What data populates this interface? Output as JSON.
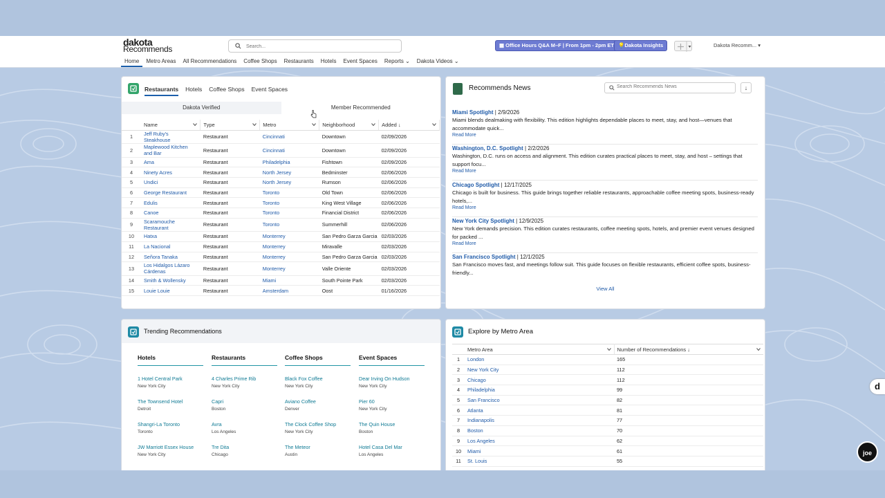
{
  "logo": {
    "line1": "dakota",
    "line2": "Recommends"
  },
  "search": {
    "placeholder": "Search..."
  },
  "header": {
    "office_hours": "Office Hours Q&A M–F  |  From 1pm - 2pm ET",
    "insights": "Dakota Insights",
    "user": "Dakota Recomm..."
  },
  "nav": [
    "Home",
    "Metro Areas",
    "All Recommendations",
    "Coffee Shops",
    "Restaurants",
    "Hotels",
    "Event Spaces",
    "Reports",
    "Dakota Videos"
  ],
  "recs": {
    "tabs": [
      "Restaurants",
      "Hotels",
      "Coffee Shops",
      "Event Spaces"
    ],
    "subtabs": [
      "Dakota Verified",
      "Member Recommended"
    ],
    "columns": [
      "Name",
      "Type",
      "Metro",
      "Neighborhood",
      "Added ↓"
    ],
    "rows": [
      {
        "n": "1",
        "name": "Jeff Ruby's Steakhouse",
        "type": "Restaurant",
        "metro": "Cincinnati",
        "hood": "Downtown",
        "added": "02/09/2026"
      },
      {
        "n": "2",
        "name": "Maplewood Kitchen and Bar",
        "type": "Restaurant",
        "metro": "Cincinnati",
        "hood": "Downtown",
        "added": "02/09/2026"
      },
      {
        "n": "3",
        "name": "Ama",
        "type": "Restaurant",
        "metro": "Philadelphia",
        "hood": "Fishtown",
        "added": "02/09/2026"
      },
      {
        "n": "4",
        "name": "Ninety Acres",
        "type": "Restaurant",
        "metro": "North Jersey",
        "hood": "Bedminster",
        "added": "02/06/2026"
      },
      {
        "n": "5",
        "name": "Undici",
        "type": "Restaurant",
        "metro": "North Jersey",
        "hood": "Rumson",
        "added": "02/06/2026"
      },
      {
        "n": "6",
        "name": "George Restaurant",
        "type": "Restaurant",
        "metro": "Toronto",
        "hood": "Old Town",
        "added": "02/06/2026"
      },
      {
        "n": "7",
        "name": "Edulis",
        "type": "Restaurant",
        "metro": "Toronto",
        "hood": "King West Village",
        "added": "02/06/2026"
      },
      {
        "n": "8",
        "name": "Canoe",
        "type": "Restaurant",
        "metro": "Toronto",
        "hood": "Financial District",
        "added": "02/06/2026"
      },
      {
        "n": "9",
        "name": "Scaramouche Restaurant",
        "type": "Restaurant",
        "metro": "Toronto",
        "hood": "Summerhill",
        "added": "02/06/2026"
      },
      {
        "n": "10",
        "name": "Hatxa",
        "type": "Restaurant",
        "metro": "Monterrey",
        "hood": "San Pedro Garza Garcia",
        "added": "02/03/2026"
      },
      {
        "n": "11",
        "name": "La Nacional",
        "type": "Restaurant",
        "metro": "Monterrey",
        "hood": "Miravalle",
        "added": "02/03/2026"
      },
      {
        "n": "12",
        "name": "Señora Tanaka",
        "type": "Restaurant",
        "metro": "Monterrey",
        "hood": "San Pedro Garza Garcia",
        "added": "02/03/2026"
      },
      {
        "n": "13",
        "name": "Los Hidalgos Lázaro Cárdenas",
        "type": "Restaurant",
        "metro": "Monterrey",
        "hood": "Valle Oriente",
        "added": "02/03/2026"
      },
      {
        "n": "14",
        "name": "Smith & Wollensky",
        "type": "Restaurant",
        "metro": "Miami",
        "hood": "South Pointe Park",
        "added": "02/03/2026"
      },
      {
        "n": "15",
        "name": "Louie Louie",
        "type": "Restaurant",
        "metro": "Amsterdam",
        "hood": "Oost",
        "added": "01/16/2026"
      }
    ]
  },
  "news": {
    "title": "Recommends News",
    "search_placeholder": "Search Recommends News",
    "read_more": "Read More",
    "view_all": "View All",
    "items": [
      {
        "title": "Miami Spotlight",
        "date": " | 2/9/2026",
        "text": "Miami blends dealmaking with flexibility. This edition highlights dependable places to meet, stay, and host—venues that accommodate quick..."
      },
      {
        "title": "Washington, D.C. Spotlight",
        "date": " | 2/2/2026",
        "text": "Washington, D.C. runs on access and alignment. This edition curates practical places to meet, stay, and host – settings that support focu..."
      },
      {
        "title": "Chicago Spotlight",
        "date": " | 12/17/2025",
        "text": "Chicago is built for business. This guide brings together reliable restaurants, approachable coffee meeting spots, business-ready hotels,..."
      },
      {
        "title": "New York City Spotlight",
        "date": " | 12/9/2025",
        "text": "New York demands precision. This edition curates restaurants, coffee meeting spots, hotels, and premier event venues designed for packed ..."
      },
      {
        "title": "San Francisco Spotlight",
        "date": " | 12/1/2025",
        "text": "San Francisco moves fast, and meetings follow suit. This guide focuses on flexible restaurants, efficient coffee spots, business-friendly..."
      }
    ]
  },
  "trending": {
    "title": "Trending Recommendations",
    "columns": [
      {
        "head": "Hotels",
        "items": [
          {
            "name": "1 Hotel Central Park",
            "city": "New York City"
          },
          {
            "name": "The Townsend Hotel",
            "city": "Detroit"
          },
          {
            "name": "Shangri-La Toronto",
            "city": "Toronto"
          },
          {
            "name": "JW Marriott Essex House",
            "city": "New York City"
          }
        ]
      },
      {
        "head": "Restaurants",
        "items": [
          {
            "name": "4 Charles Prime Rib",
            "city": "New York City"
          },
          {
            "name": "Capri",
            "city": "Boston"
          },
          {
            "name": "Avra",
            "city": "Los Angeles"
          },
          {
            "name": "Tre Dita",
            "city": "Chicago"
          }
        ]
      },
      {
        "head": "Coffee Shops",
        "items": [
          {
            "name": "Black Fox Coffee",
            "city": "New York City"
          },
          {
            "name": "Aviano Coffee",
            "city": "Denver"
          },
          {
            "name": "The Clock Coffee Shop",
            "city": "New York City"
          },
          {
            "name": "The Meteor",
            "city": "Austin"
          }
        ]
      },
      {
        "head": "Event Spaces",
        "items": [
          {
            "name": "Dear Irving On Hudson",
            "city": "New York City"
          },
          {
            "name": "Pier 60",
            "city": "New York City"
          },
          {
            "name": "The Quin House",
            "city": "Boston"
          },
          {
            "name": "Hotel Casa Del Mar",
            "city": "Los Angeles"
          }
        ]
      }
    ]
  },
  "metro": {
    "title": "Explore by Metro Area",
    "columns": [
      "Metro Area",
      "Number of Recommendations ↓"
    ],
    "rows": [
      {
        "n": "1",
        "area": "London",
        "count": "165"
      },
      {
        "n": "2",
        "area": "New York City",
        "count": "112"
      },
      {
        "n": "3",
        "area": "Chicago",
        "count": "112"
      },
      {
        "n": "4",
        "area": "Philadelphia",
        "count": "99"
      },
      {
        "n": "5",
        "area": "San Francisco",
        "count": "82"
      },
      {
        "n": "6",
        "area": "Atlanta",
        "count": "81"
      },
      {
        "n": "7",
        "area": "Indianapolis",
        "count": "77"
      },
      {
        "n": "8",
        "area": "Boston",
        "count": "70"
      },
      {
        "n": "9",
        "area": "Los Angeles",
        "count": "62"
      },
      {
        "n": "10",
        "area": "Miami",
        "count": "61"
      },
      {
        "n": "11",
        "area": "St. Louis",
        "count": "55"
      }
    ]
  },
  "widgets": {
    "d_button": "d",
    "joe_button": "joe"
  },
  "colors": {
    "accent": "#1b5eab",
    "pill": "#6d7bd2",
    "teal": "#1f95a5",
    "green": "#34a56b"
  }
}
